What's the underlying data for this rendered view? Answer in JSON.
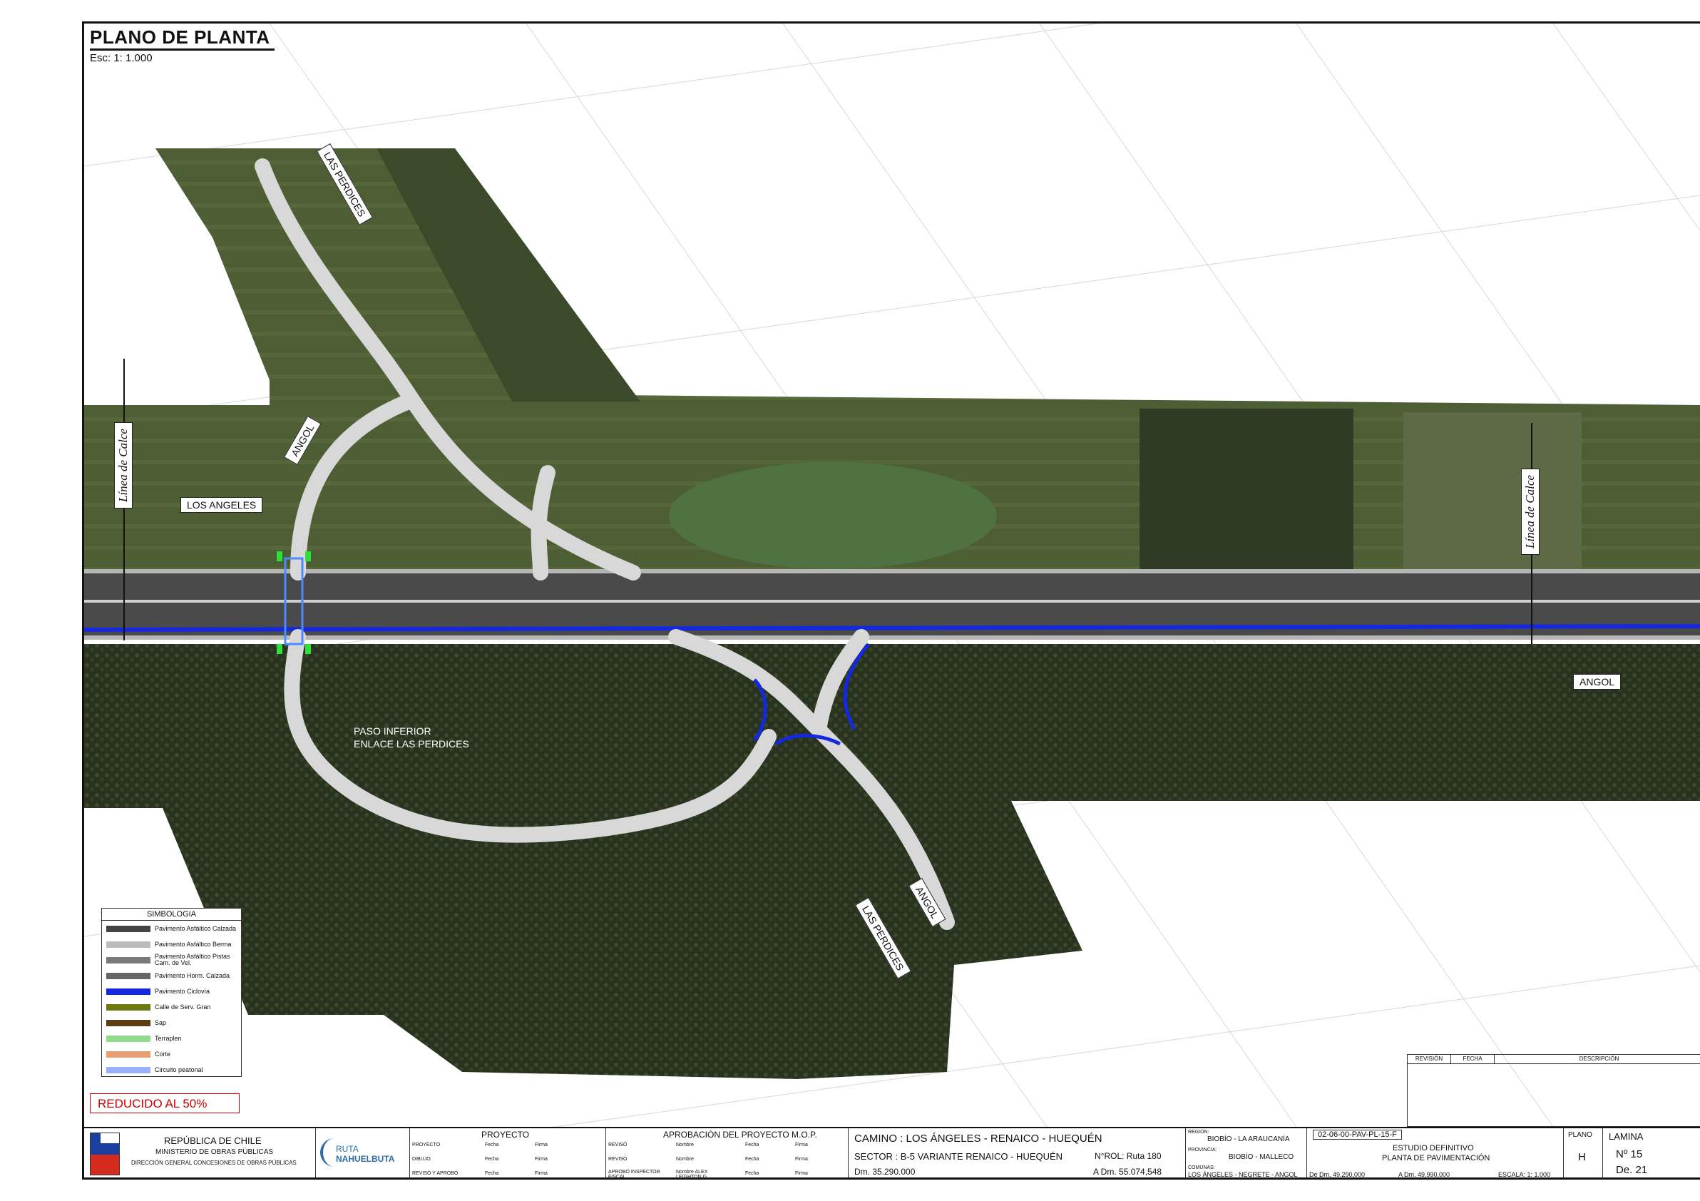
{
  "header": {
    "title": "PLANO DE PLANTA",
    "scale": "Esc: 1: 1.000"
  },
  "map_labels": {
    "las_perdices_top": "LAS PERDICES",
    "angol_left": "ANGOL",
    "los_angeles": "LOS ANGELES",
    "linea_calce_left": "Línea de Calce",
    "linea_calce_right": "Línea de Calce",
    "paso_inferior": "PASO INFERIOR",
    "enlace": "ENLACE LAS PERDICES",
    "angol_right": "ANGOL",
    "angol_bottom": "ANGOL",
    "las_perdices_bottom": "LAS PERDICES"
  },
  "legend": {
    "title": "SIMBOLOGIA",
    "items": [
      {
        "label": "Pavimento Asfáltico Calzada",
        "color": "#444444"
      },
      {
        "label": "Pavimento Asfáltico Berma",
        "color": "#bbbbbb"
      },
      {
        "label": "Pavimento Asfáltico Pistas Cam. de Vel.",
        "color": "#7a7a7a"
      },
      {
        "label": "Pavimento Horm. Calzada",
        "color": "#666666"
      },
      {
        "label": "Pavimento Ciclovía",
        "color": "#1428e0"
      },
      {
        "label": "Calle de Serv. Gran",
        "color": "#6e7a10"
      },
      {
        "label": "Sap",
        "color": "#5a3d10"
      },
      {
        "label": "Terraplen",
        "color": "#8fdc8f"
      },
      {
        "label": "Corte",
        "color": "#e8a070"
      },
      {
        "label": "Circuito peatonal",
        "color": "#9ab0ff"
      }
    ]
  },
  "stamp": "REDUCIDO AL 50%",
  "revision_table": {
    "cols": [
      "REVISIÓN",
      "FECHA",
      "DESCRIPCIÓN"
    ]
  },
  "titleblock": {
    "republica": "REPÚBLICA DE CHILE",
    "ministerio": "MINISTERIO DE OBRAS PÚBLICAS",
    "direccion": "DIRECCIÓN GENERAL CONCESIONES DE OBRAS PÚBLICAS",
    "logo_ruta": "RUTA",
    "logo_nahuel": "NAHUELBUTA",
    "proyecto": "PROYECTO",
    "aprobacion": "APROBACIÓN DEL PROYECTO M.O.P.",
    "roles_left": [
      "PROYECTO",
      "DIBUJO",
      "REVISÓ Y APROBÓ"
    ],
    "roles_right": [
      "REVISÓ",
      "REVISÓ",
      "APROBÓ INSPECTOR FISCAL"
    ],
    "fecha": "Fecha",
    "firma": "Firma",
    "nombre": "Nombre",
    "nombre_final": "Nombre ALEX LEIGHTON G.",
    "camino": "CAMINO : LOS ÁNGELES - RENAICO - HUEQUÉN",
    "sector": "SECTOR : B-5 VARIANTE RENAICO - HUEQUÉN",
    "rol": "N°ROL: Ruta 180",
    "dm": "Dm.    35.290.000",
    "adm": "A Dm.   55.074,548",
    "region_lbl": "REGION:",
    "region": "BIOBÍO - LA ARAUCANÍA",
    "provincia_lbl": "PROVINCIA:",
    "provincia": "BIOBÍO - MALLECO",
    "comunas_lbl": "COMUNAS:",
    "comunas": "LOS ÁNGELES - NEGRETE - ANGOL",
    "codigo": "02-06-00-PAV-PL-15-F",
    "estudio": "ESTUDIO DEFINITIVO",
    "planta": "PLANTA DE PAVIMENTACIÓN",
    "de_dm": "De Dm. 49.290,000",
    "a_dm": "A Dm.  49.990,000",
    "escala": "ESCALA:  1: 1.000",
    "plano_lbl": "PLANO",
    "plano": "H",
    "lamina_lbl": "LAMINA",
    "lamina_no": "Nº    15",
    "lamina_de": "De. 21"
  }
}
